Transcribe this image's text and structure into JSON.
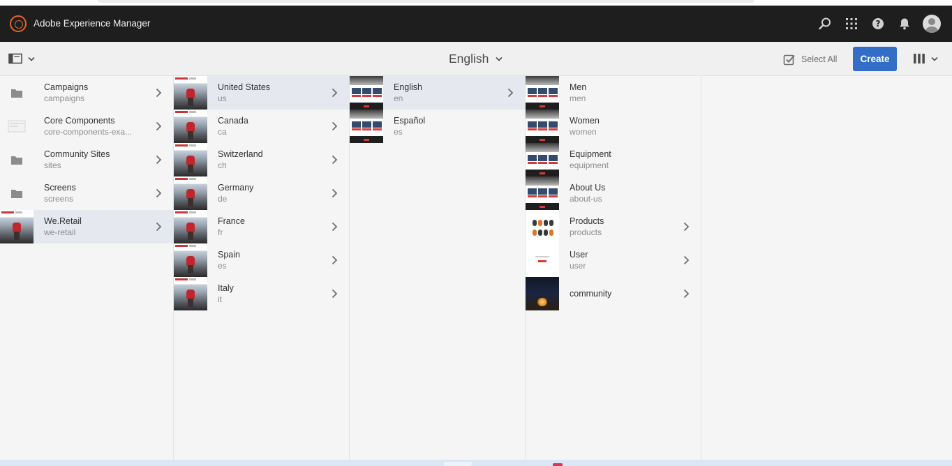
{
  "shell": {
    "app_title": "Adobe Experience Manager",
    "icons": [
      "adobe-experience-manager-logo",
      "search-icon",
      "apps-grid-icon",
      "help-icon",
      "bell-icon",
      "avatar"
    ]
  },
  "actionbar": {
    "title": "English",
    "select_all_label": "Select All",
    "create_label": "Create",
    "accent_color": "#326ec8"
  },
  "columns": [
    {
      "items": [
        {
          "label": "Campaigns",
          "sub": "campaigns",
          "thumb": "folder",
          "has_children": true,
          "active": false
        },
        {
          "label": "Core Components",
          "sub": "core-components-exa...",
          "thumb": "component",
          "has_children": true,
          "active": false
        },
        {
          "label": "Community Sites",
          "sub": "sites",
          "thumb": "folder",
          "has_children": true,
          "active": false
        },
        {
          "label": "Screens",
          "sub": "screens",
          "thumb": "folder",
          "has_children": true,
          "active": false
        },
        {
          "label": "We.Retail",
          "sub": "we-retail",
          "thumb": "hero",
          "has_children": true,
          "active": true
        }
      ]
    },
    {
      "items": [
        {
          "label": "United States",
          "sub": "us",
          "thumb": "hero",
          "has_children": true,
          "active": true
        },
        {
          "label": "Canada",
          "sub": "ca",
          "thumb": "hero",
          "has_children": true,
          "active": false
        },
        {
          "label": "Switzerland",
          "sub": "ch",
          "thumb": "hero",
          "has_children": true,
          "active": false
        },
        {
          "label": "Germany",
          "sub": "de",
          "thumb": "hero",
          "has_children": true,
          "active": false
        },
        {
          "label": "France",
          "sub": "fr",
          "thumb": "hero",
          "has_children": true,
          "active": false
        },
        {
          "label": "Spain",
          "sub": "es",
          "thumb": "hero",
          "has_children": true,
          "active": false
        },
        {
          "label": "Italy",
          "sub": "it",
          "thumb": "hero",
          "has_children": true,
          "active": false
        }
      ]
    },
    {
      "items": [
        {
          "label": "English",
          "sub": "en",
          "thumb": "grid",
          "has_children": true,
          "active": true
        },
        {
          "label": "Español",
          "sub": "es",
          "thumb": "grid",
          "has_children": false,
          "active": false
        }
      ]
    },
    {
      "items": [
        {
          "label": "Men",
          "sub": "men",
          "thumb": "grid",
          "has_children": false,
          "active": false
        },
        {
          "label": "Women",
          "sub": "women",
          "thumb": "grid",
          "has_children": false,
          "active": false
        },
        {
          "label": "Equipment",
          "sub": "equipment",
          "thumb": "grid",
          "has_children": false,
          "active": false
        },
        {
          "label": "About Us",
          "sub": "about-us",
          "thumb": "grid",
          "has_children": false,
          "active": false
        },
        {
          "label": "Products",
          "sub": "products",
          "thumb": "products",
          "has_children": true,
          "active": false
        },
        {
          "label": "User",
          "sub": "user",
          "thumb": "user",
          "has_children": true,
          "active": false
        },
        {
          "label": "community",
          "sub": "",
          "thumb": "community",
          "has_children": true,
          "active": false
        }
      ]
    }
  ]
}
